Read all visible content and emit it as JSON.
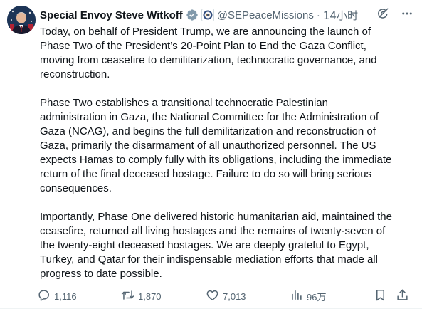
{
  "author": {
    "name": "Special Envoy Steve Witkoff",
    "handle": "@SEPeaceMissions",
    "separator": "·",
    "time": "14小时"
  },
  "tweet": {
    "paragraphs": [
      "Today, on behalf of President Trump, we are announcing the launch of\nPhase Two of the President’s 20-Point Plan to End the Gaza Conflict,\nmoving from ceasefire to demilitarization, technocratic governance, and\nreconstruction.",
      "Phase Two establishes a transitional technocratic Palestinian\nadministration in Gaza, the National Committee for the Administration of\nGaza (NCAG), and begins the full demilitarization and reconstruction of\nGaza, primarily the disarmament of all unauthorized personnel. The US\nexpects Hamas to comply fully with its obligations, including the immediate\nreturn of the final deceased hostage. Failure to do so will bring serious\nconsequences.",
      "Importantly, Phase One delivered historic humanitarian aid, maintained the\nceasefire, returned all living hostages and the remains of twenty-seven of\nthe twenty-eight deceased hostages. We are deeply grateful to Egypt,\nTurkey, and Qatar for their indispensable mediation efforts that made all\nprogress to date possible."
    ]
  },
  "metrics": {
    "replies": "1,116",
    "retweets": "1,870",
    "likes": "7,013",
    "views": "96万"
  },
  "icons": {
    "verified": "verified-badge-icon",
    "affiliation": "government-seal-icon",
    "grok": "grok-icon",
    "more": "more-icon",
    "reply": "reply-icon",
    "retweet": "retweet-icon",
    "like": "like-icon",
    "views": "views-icon",
    "bookmark": "bookmark-icon",
    "share": "share-icon"
  },
  "colors": {
    "text": "#0f1419",
    "secondary": "#536471",
    "verified": "#829aab",
    "background": "#ffffff"
  }
}
